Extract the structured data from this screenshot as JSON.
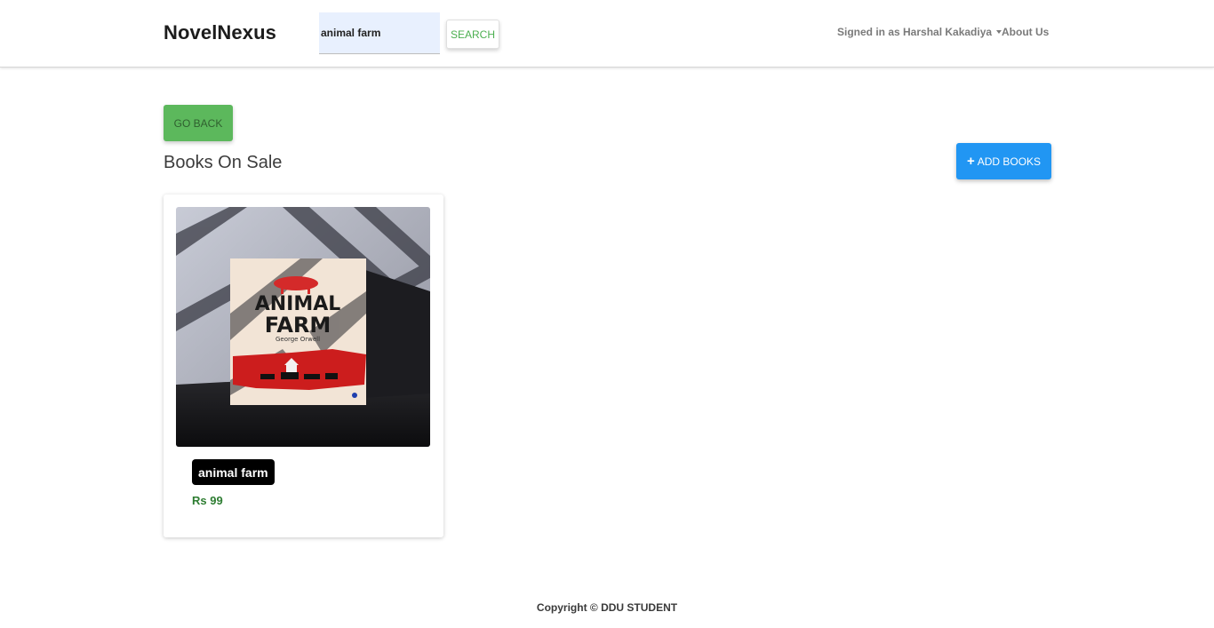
{
  "navbar": {
    "brand": "NovelNexus",
    "search": {
      "value": "animal farm",
      "placeholder": ""
    },
    "search_button": "SEARCH",
    "user_menu": "Signed in as Harshal Kakadiya",
    "about": "About Us"
  },
  "main": {
    "go_back_label": "GO BACK",
    "section_title": "Books On Sale",
    "add_books_label": "ADD BOOKS",
    "books": [
      {
        "title": "animal farm",
        "price": "Rs 99",
        "cover": {
          "title_line1": "ANIMAL",
          "title_line2": "FARM",
          "author": "George Orwell"
        }
      }
    ]
  },
  "footer": {
    "copyright": "Copyright © DDU STUDENT"
  },
  "colors": {
    "search_button_text": "#4caf50",
    "go_back_bg": "#5cb85c",
    "add_books_bg": "#2196f3",
    "price": "#2e7d32",
    "search_field_bg": "#e8f0fe"
  },
  "icons": {
    "add_books": "plus-icon",
    "user_menu": "caret-down-icon"
  }
}
